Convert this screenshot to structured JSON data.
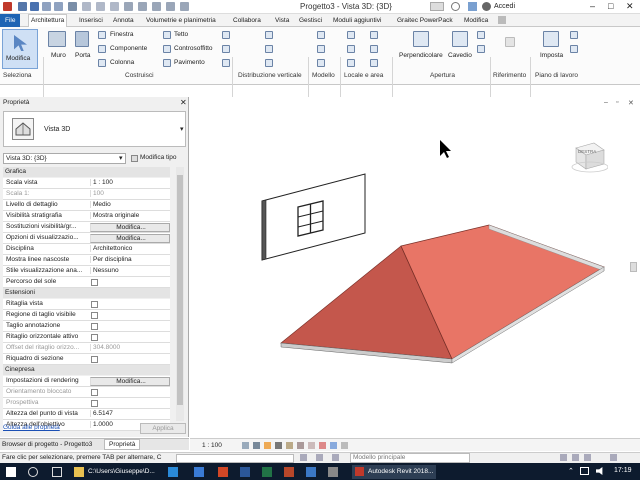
{
  "titlebar": {
    "title": "Progetto3 - Vista 3D: {3D}",
    "account": "Accedi"
  },
  "tabs": [
    "File",
    "Architettura",
    "Inserisci",
    "Annota",
    "Volumetrie e planimetria",
    "Collabora",
    "Vista",
    "Gestisci",
    "Moduli aggiuntivi",
    "Graitec PowerPack",
    "Modifica"
  ],
  "ribbon": {
    "modifica": "Modifica",
    "muro": "Muro",
    "porta": "Porta",
    "finestra": "Finestra",
    "componente": "Componente",
    "colonna": "Colonna",
    "tetto": "Tetto",
    "controsoffitto": "Controsoffitto",
    "pavimento": "Pavimento",
    "perpendicolare": "Perpendicolare",
    "cavedio": "Cavedio",
    "imposta": "Imposta",
    "panels": [
      "Seleziona",
      "Costruisci",
      "Distribuzione verticale",
      "Modello",
      "Locale e area",
      "Apertura",
      "Riferimento",
      "Piano di lavoro"
    ]
  },
  "properties": {
    "header": "Proprietà",
    "type_name": "Vista 3D",
    "selector": "Vista 3D: {3D}",
    "edit_type": "Modifica tipo",
    "sections": {
      "graphics": "Grafica",
      "extents": "Estensioni",
      "camera": "Cinepresa"
    },
    "graphics_rows": [
      {
        "k": "Scala vista",
        "v": "1 : 100"
      },
      {
        "k": "Scala   1:",
        "v": "100",
        "dim": true
      },
      {
        "k": "Livello di dettaglio",
        "v": "Medio"
      },
      {
        "k": "Visibilità stratigrafia",
        "v": "Mostra originale"
      },
      {
        "k": "Sostituzioni visibilità/gr...",
        "v": "Modifica...",
        "btn": true
      },
      {
        "k": "Opzioni di visualizzazio...",
        "v": "Modifica...",
        "btn": true
      },
      {
        "k": "Disciplina",
        "v": "Architettonico"
      },
      {
        "k": "Mostra linee nascoste",
        "v": "Per disciplina"
      },
      {
        "k": "Stile visualizzazione ana...",
        "v": "Nessuno"
      },
      {
        "k": "Percorso del sole",
        "v": "",
        "cb": true
      }
    ],
    "extents_rows": [
      {
        "k": "Ritaglia vista",
        "v": "",
        "cb": true
      },
      {
        "k": "Regione di taglio visibile",
        "v": "",
        "cb": true
      },
      {
        "k": "Taglio annotazione",
        "v": "",
        "cb": true
      },
      {
        "k": "Ritaglio orizzontale attivo",
        "v": "",
        "cb": true
      },
      {
        "k": "Offset del ritaglio orizzo...",
        "v": "304.8000",
        "dim": true
      },
      {
        "k": "Riquadro di sezione",
        "v": "",
        "cb": true
      }
    ],
    "camera_rows": [
      {
        "k": "Impostazioni di rendering",
        "v": "Modifica...",
        "btn": true
      },
      {
        "k": "Orientamento bloccato",
        "v": "",
        "cb": true,
        "dim": true
      },
      {
        "k": "Prospettiva",
        "v": "",
        "cb": true,
        "dim": true
      },
      {
        "k": "Altezza del punto di vista",
        "v": "6.5147"
      },
      {
        "k": "Altezza dell'obiettivo",
        "v": "1.0000"
      }
    ],
    "help_link": "Guida alle proprietà",
    "apply": "Applica",
    "bottom_tabs": [
      "Browser di progetto - Progetto3",
      "Proprietà"
    ]
  },
  "view": {
    "viewcube_label": "DESTRA",
    "scale": "1 : 100"
  },
  "statusbar": {
    "hint": "Fare clic per selezionare, premere TAB per alternare, C",
    "model": "Modello principale"
  },
  "taskbar": {
    "items": [
      "C:\\Users\\Giuseppe\\D...",
      "Autodesk Revit 2018..."
    ],
    "clock": "17:19"
  },
  "colors": {
    "roof_light": "#e87566",
    "roof_dark": "#c4574c",
    "accent": "#1e64b4"
  }
}
